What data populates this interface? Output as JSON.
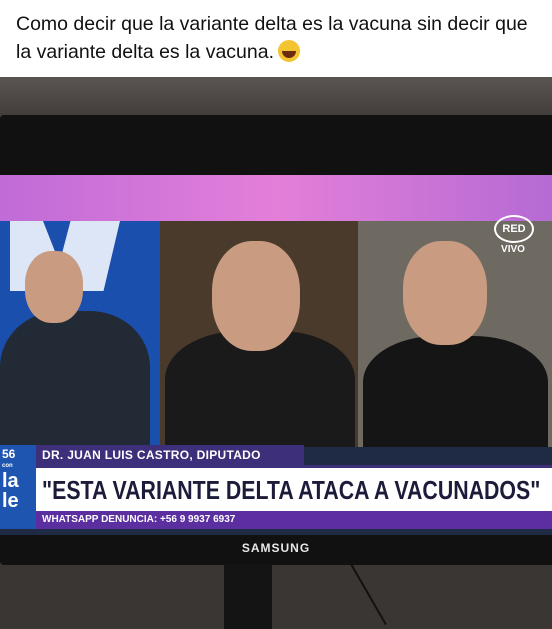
{
  "caption": {
    "text": "Como decir que la variante delta es la vacuna sin decir que la variante delta es la vacuna.",
    "emoji": "laughing-face-emoji"
  },
  "tv": {
    "brand": "SAMSUNG",
    "channel_logo": "RED",
    "live_label": "VIVO",
    "name_label": "DR. JUAN LUIS CASTRO, DIPUTADO",
    "headline": "\"ESTA VARIANTE DELTA ATACA A VACUNADOS\"",
    "ticker": "WHATSAPP DENUNCIA: +56 9 9937 6937",
    "side_text": [
      "56",
      "con",
      "la",
      "le"
    ]
  },
  "colors": {
    "banner_purple": "#3e2f7a",
    "ticker_purple": "#5b2fa0",
    "screen_top_pink": "#e37fd9",
    "panel_blue": "#1b4fae"
  }
}
